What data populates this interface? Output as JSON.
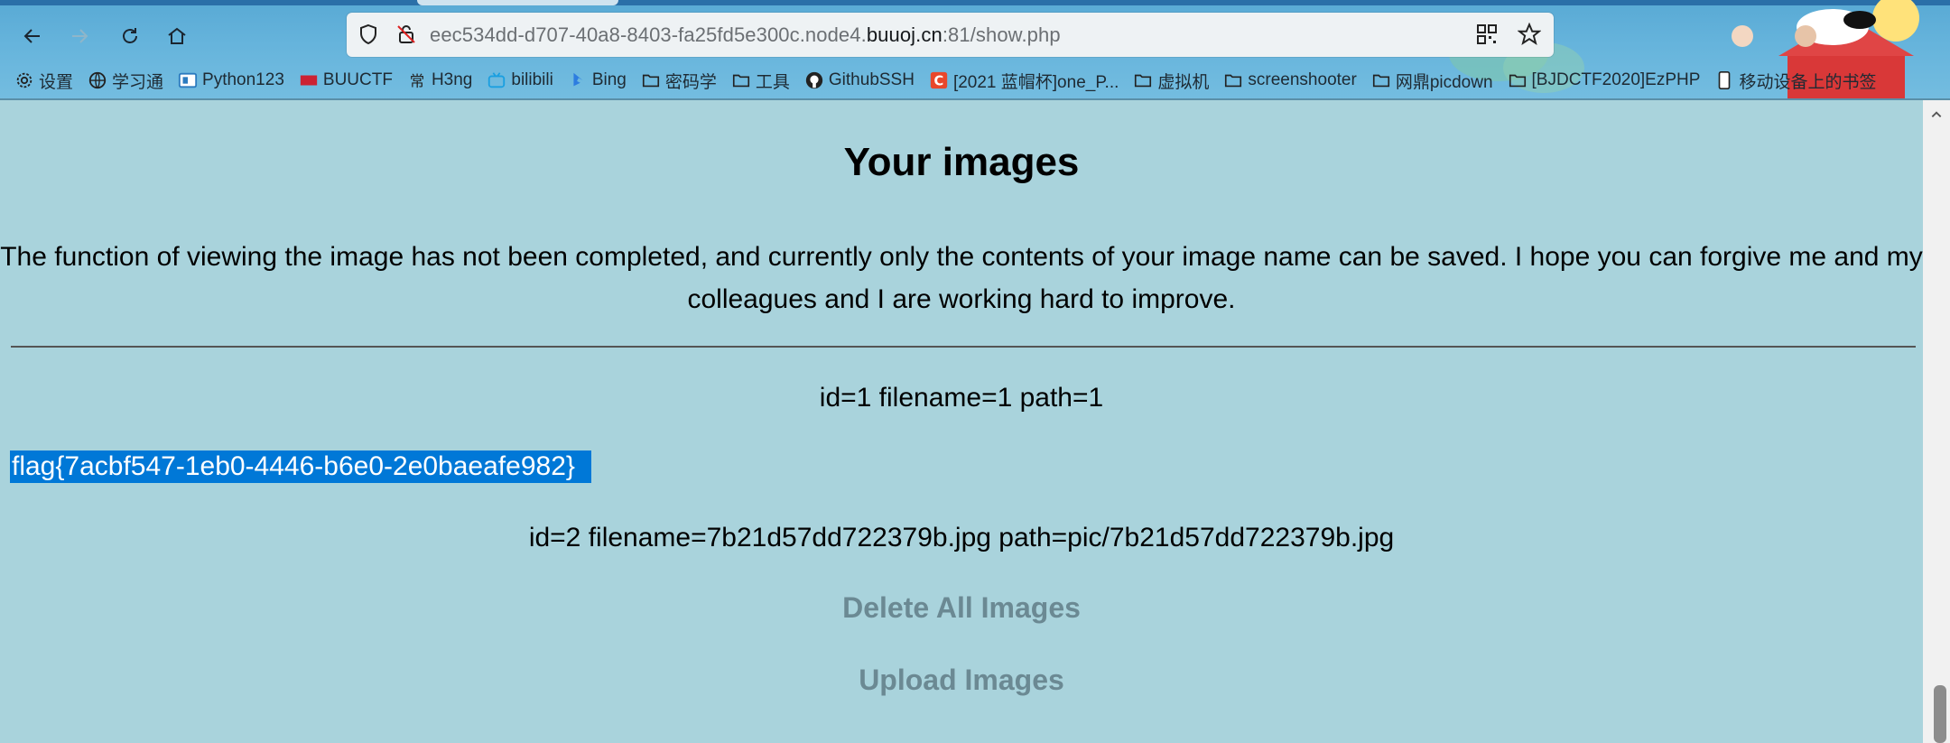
{
  "browser": {
    "url_prefix": "eec534dd-d707-40a8-8403-fa25fd5e300c.node4.",
    "url_domain": "buuoj.cn",
    "url_suffix": ":81/show.php"
  },
  "bookmarks": [
    {
      "label": "设置",
      "icon": "gear-icon"
    },
    {
      "label": "学习通",
      "icon": "globe-icon"
    },
    {
      "label": "Python123",
      "icon": "python123-icon"
    },
    {
      "label": "BUUCTF",
      "icon": "buuctf-icon"
    },
    {
      "label": "H3ng",
      "icon": "h3ng-icon"
    },
    {
      "label": "bilibili",
      "icon": "bilibili-icon"
    },
    {
      "label": "Bing",
      "icon": "bing-icon"
    },
    {
      "label": "密码学",
      "icon": "folder-icon"
    },
    {
      "label": "工具",
      "icon": "folder-icon"
    },
    {
      "label": "GithubSSH",
      "icon": "github-icon"
    },
    {
      "label": "[2021 蓝帽杯]one_P...",
      "icon": "csdn-icon"
    },
    {
      "label": "虚拟机",
      "icon": "folder-icon"
    },
    {
      "label": "screenshooter",
      "icon": "folder-icon"
    },
    {
      "label": "网鼎picdown",
      "icon": "folder-icon"
    },
    {
      "label": "[BJDCTF2020]EzPHP",
      "icon": "folder-icon"
    },
    {
      "label": "移动设备上的书签",
      "icon": "mobile-icon"
    }
  ],
  "page": {
    "title": "Your images",
    "intro": "The function of viewing the image has not been completed, and currently only the contents of your image name can be saved. I hope you can forgive me and my colleagues and I are working hard to improve.",
    "record1": "id=1 filename=1 path=1",
    "flag": "flag{7acbf547-1eb0-4446-b6e0-2e0baeafe982}",
    "record2": "id=2 filename=7b21d57dd722379b.jpg path=pic/7b21d57dd722379b.jpg",
    "delete_link": "Delete All Images",
    "upload_link": "Upload Images"
  },
  "colors": {
    "page_background": "#a9d3dc",
    "selection": "#0078d7",
    "link": "#6b8993"
  }
}
